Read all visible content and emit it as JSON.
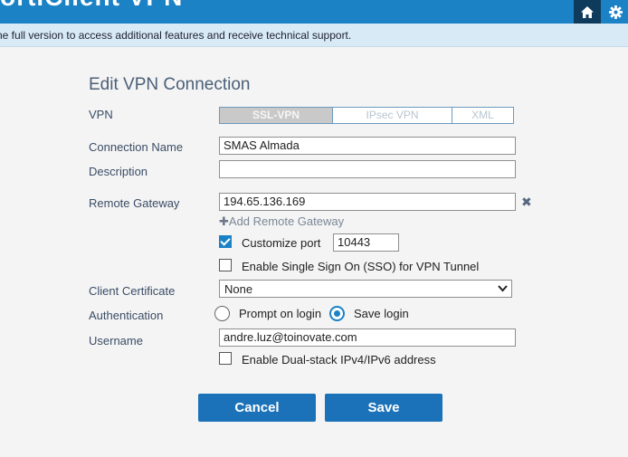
{
  "app": {
    "title": "FortiClient VPN"
  },
  "notice": {
    "text": "ne full version to access additional features and receive technical support."
  },
  "form": {
    "heading": "Edit VPN Connection",
    "vpn_label": "VPN",
    "vpn_types": [
      "SSL-VPN",
      "IPsec VPN",
      "XML"
    ],
    "vpn_selected": "SSL-VPN",
    "connection_name_label": "Connection Name",
    "connection_name_value": "SMAS Almada",
    "description_label": "Description",
    "description_value": "",
    "remote_gateway_label": "Remote Gateway",
    "remote_gateway_value": "194.65.136.169",
    "add_gateway_label": "Add Remote Gateway",
    "customize_port_label": "Customize port",
    "customize_port_checked": true,
    "port_value": "10443",
    "sso_label": "Enable Single Sign On (SSO) for VPN Tunnel",
    "sso_checked": false,
    "client_cert_label": "Client Certificate",
    "client_cert_value": "None",
    "auth_label": "Authentication",
    "auth_options": [
      "Prompt on login",
      "Save login"
    ],
    "auth_selected": "Save login",
    "username_label": "Username",
    "username_value": "andre.luz@toinovate.com",
    "dualstack_label": "Enable Dual-stack IPv4/IPv6 address",
    "dualstack_checked": false
  },
  "buttons": {
    "cancel": "Cancel",
    "save": "Save"
  },
  "colors": {
    "accent": "#1b82c6",
    "button": "#1b72b8",
    "notice_bg": "#d7eaf6"
  }
}
